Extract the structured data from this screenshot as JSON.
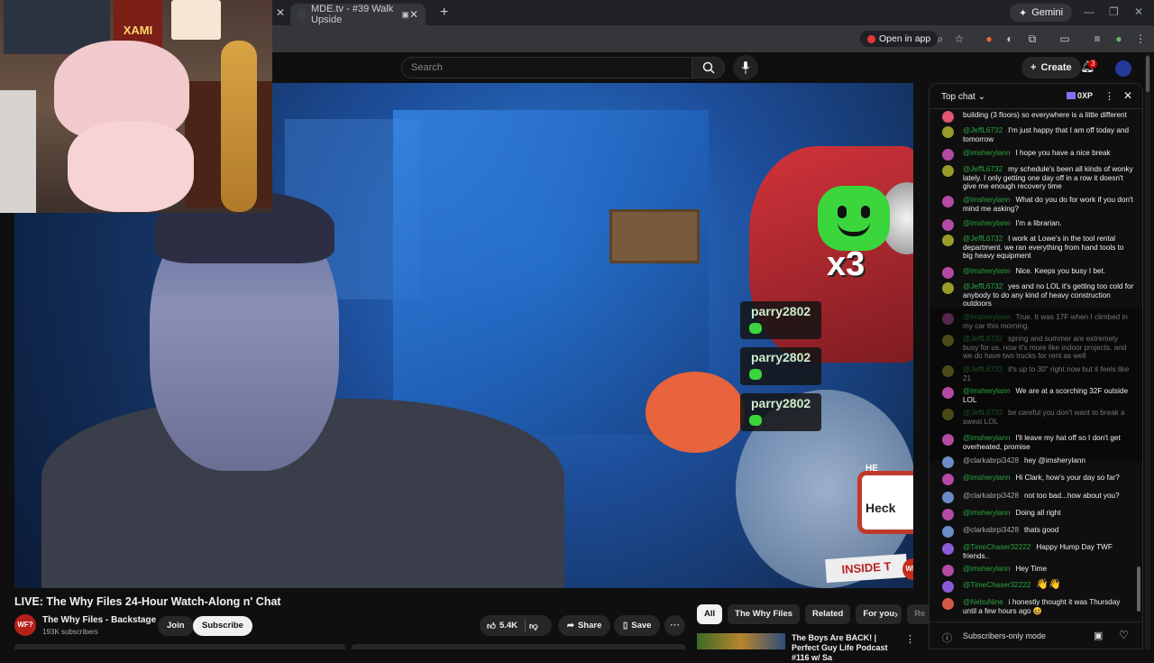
{
  "browser": {
    "active_tab": "MDE.tv - #39 Walk Upside",
    "gemini_label": "Gemini",
    "open_in_app": "Open in app"
  },
  "yt": {
    "search_placeholder": "Search",
    "create_label": "Create",
    "notif_count": "3"
  },
  "video": {
    "emote_multiplier": "x3",
    "alerts": [
      "parry2802",
      "parry2802",
      "parry2802"
    ],
    "sign_hello": "HE",
    "sign_name": "Heck",
    "inside_sign": "INSIDE T",
    "wf_badge": "WF?"
  },
  "webcam": {
    "poster_text": "XAMI"
  },
  "meta": {
    "title": "LIVE: The Why Files 24-Hour Watch-Along n' Chat",
    "channel": "The Why Files - Backstage",
    "subs": "193K subscribers",
    "channel_avatar": "WF?",
    "join": "Join",
    "subscribe": "Subscribe",
    "likes": "5.4K",
    "share": "Share",
    "save": "Save"
  },
  "chips": [
    "All",
    "The Why Files",
    "Related",
    "For you",
    "Re"
  ],
  "rec": {
    "title": "The Boys Are BACK! | Perfect Guy Life Podcast #116 w/ Sa"
  },
  "chat": {
    "title": "Top chat",
    "xp": "0XP",
    "footer": "Subscribers-only mode",
    "messages": [
      {
        "author": "",
        "text": "building (3 floors) so everywhere is a little different",
        "color": "#e0556f"
      },
      {
        "author": "@JeffL6732",
        "text": "I'm just happy that I am off today and tomorrow",
        "color": "#9a9a2a"
      },
      {
        "author": "@imsherylann",
        "text": "I hope you have a nice break",
        "color": "#b34aa3"
      },
      {
        "author": "@JeffL6732",
        "text": "my schedule's been all kinds of wonky lately. I only getting one day off in a row it doesn't give me enough recovery time",
        "color": "#9a9a2a"
      },
      {
        "author": "@imsherylann",
        "text": "What do you do for work if you don't mind me asking?",
        "color": "#b34aa3"
      },
      {
        "author": "@imsherylann",
        "text": "I'm a librarian.",
        "color": "#b34aa3"
      },
      {
        "author": "@JeffL6732",
        "text": "I work at Lowe's in the tool rental department. we ran everything from hand tools to big heavy equipment",
        "color": "#9a9a2a"
      },
      {
        "author": "@imsherylann",
        "text": "Nice. Keeps you busy I bet.",
        "color": "#b34aa3"
      },
      {
        "author": "@JeffL6732",
        "text": "yes and no LOL it's getting too cold for anybody to do any kind of heavy construction outdoors",
        "color": "#9a9a2a"
      },
      {
        "author": "@imsherylann",
        "text": "True. It was 17F when I climbed in my car this morning.",
        "color": "#b34aa3"
      },
      {
        "author": "@JeffL6732",
        "text": "spring and summer are extremely busy for us. now it's more like indoor projects. and we do have two trucks for rent as well",
        "color": "#9a9a2a"
      },
      {
        "author": "@JeffL6732",
        "text": "it's up to 30\" right now but it feels like 21",
        "color": "#9a9a2a"
      },
      {
        "author": "@imsherylann",
        "text": "We are at a scorching 32F outside LOL",
        "color": "#b34aa3"
      },
      {
        "author": "@JeffL6732",
        "text": "be careful you don't want to break a sweat LOL",
        "color": "#9a9a2a"
      },
      {
        "author": "@imsherylann",
        "text": "I'll leave my hat off so I don't get overheated, promise",
        "color": "#b34aa3"
      },
      {
        "author": "@clarkabrpi3428",
        "text": "hey @imsherylann",
        "color": "#6a8cc7"
      },
      {
        "author": "@imsherylann",
        "text": "Hi Clark, how's your day so far?",
        "color": "#b34aa3"
      },
      {
        "author": "@clarkabrpi3428",
        "text": "not too bad...how about you?",
        "color": "#6a8cc7"
      },
      {
        "author": "@imsherylann",
        "text": "Doing all right",
        "color": "#b34aa3"
      },
      {
        "author": "@clarkabrpi3428",
        "text": "thats good",
        "color": "#6a8cc7"
      },
      {
        "author": "@TimeChaser32222",
        "text": "Happy Hump Day TWF friends..",
        "color": "#8c5ad6"
      },
      {
        "author": "@imsherylann",
        "text": "Hey Time",
        "color": "#b34aa3"
      },
      {
        "author": "@TimeChaser32222",
        "text": "👋👋",
        "color": "#8c5ad6"
      },
      {
        "author": "@NebuNine",
        "text": "i honestly thought it was Thursday until a few hours ago 😆",
        "color": "#d4584a"
      }
    ]
  }
}
